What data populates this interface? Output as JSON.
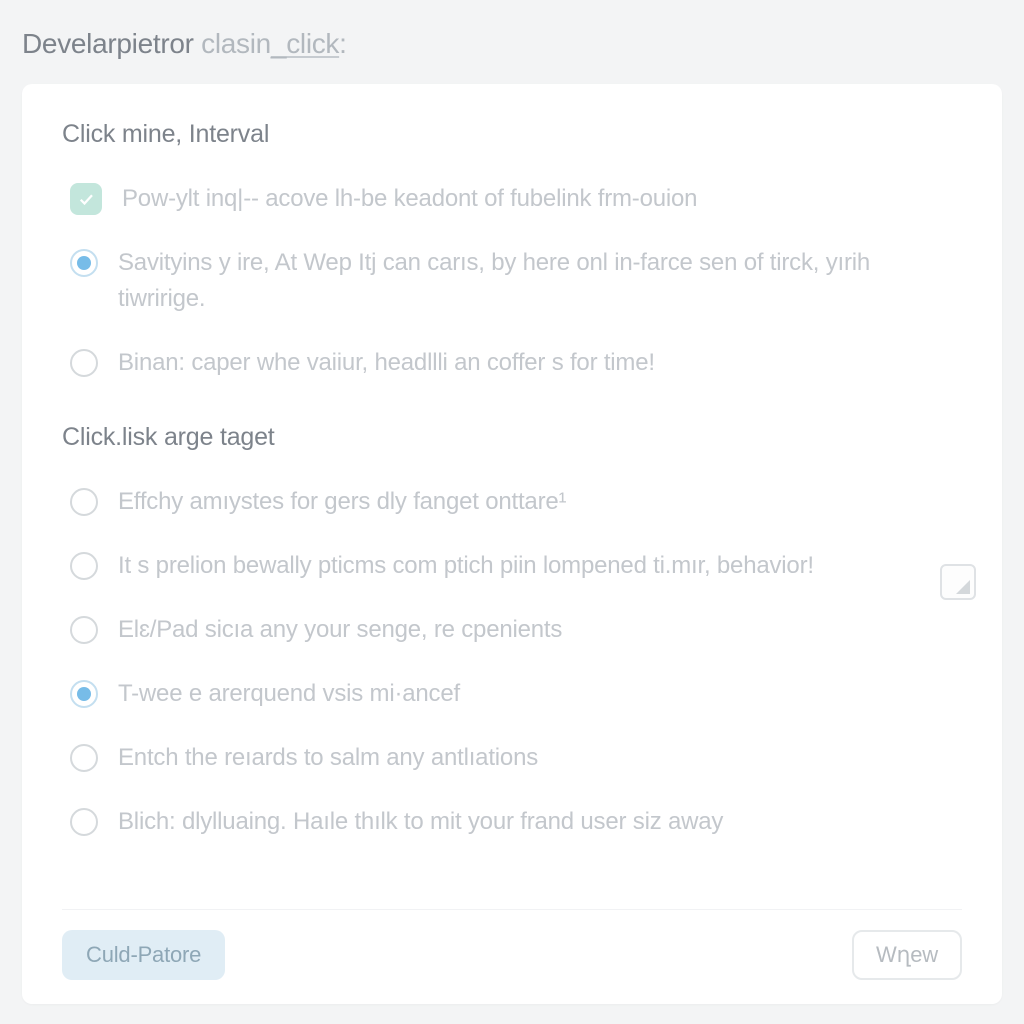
{
  "header": {
    "part1": "Develarpietror",
    "part2": " clasin",
    "part3": "_click",
    "colon": ":"
  },
  "sections": [
    {
      "heading": "Click mine, Interval",
      "options": [
        {
          "type": "checkbox",
          "selected": true,
          "label": "Pow-ylt inq|-- acove lh-be keadont of fubelink frm-ouion"
        },
        {
          "type": "radio",
          "selected": true,
          "label": "Savityins y ire, At Wep Itj can carıs, by here onl in-farce sen of tirck, yırih tiwririge."
        },
        {
          "type": "radio",
          "selected": false,
          "label": "Binan: caper whe vaiiur, headllli an coffer s for time!"
        }
      ]
    },
    {
      "heading": "Click.lisk arge taget",
      "options": [
        {
          "type": "radio",
          "selected": false,
          "label": "Effchy amıystes for gers dly fanget onttare¹"
        },
        {
          "type": "radio",
          "selected": false,
          "label": "It s prelion bewally pticms com ptich piin lompened ti.mır, behavior!"
        },
        {
          "type": "radio",
          "selected": false,
          "label": "Elɛ/Pad sicıa any your senge, re cpenients"
        },
        {
          "type": "radio",
          "selected": true,
          "label": "T-wee e arerquend vsis mi·ancef"
        },
        {
          "type": "radio",
          "selected": false,
          "label": "Entch the reıards to salm any antlıations"
        },
        {
          "type": "radio",
          "selected": false,
          "label": "Blich: dlylluaing. Haıle thılk to mit your frand user siz away"
        }
      ]
    }
  ],
  "footer": {
    "primary_label": "Culd-Patore",
    "secondary_label": "Wղew"
  }
}
